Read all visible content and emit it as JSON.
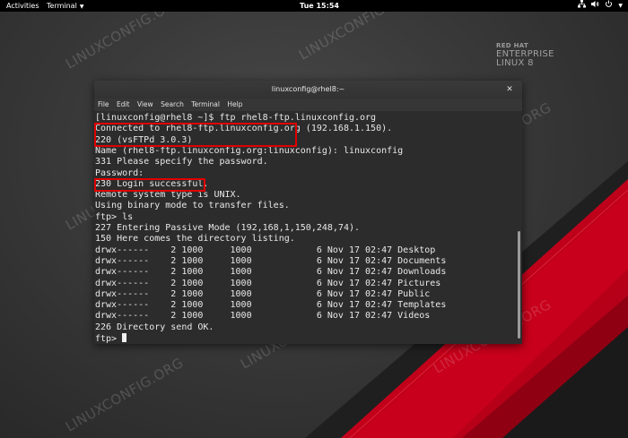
{
  "topbar": {
    "activities": "Activities",
    "app_menu": "Terminal",
    "clock": "Tue 15:54",
    "tray_icons": [
      "network-icon",
      "volume-icon",
      "power-icon",
      "chevron-down-icon"
    ]
  },
  "desktop": {
    "watermark_text": "LINUXCONFIG.ORG",
    "logo": {
      "line1": "RED HAT",
      "line2": "ENTERPRISE",
      "line3": "LINUX 8"
    },
    "colors": {
      "accent_red": "#d3001c",
      "background": "#333333"
    }
  },
  "window": {
    "title": "linuxconfig@rhel8:~",
    "menu": [
      "File",
      "Edit",
      "View",
      "Search",
      "Terminal",
      "Help"
    ],
    "lines": [
      "[linuxconfig@rhel8 ~]$ ftp rhel8-ftp.linuxconfig.org",
      "Connected to rhel8-ftp.linuxconfig.org (192.168.1.150).",
      "220 (vsFTPd 3.0.3)",
      "Name (rhel8-ftp.linuxconfig.org:linuxconfig): linuxconfig",
      "331 Please specify the password.",
      "Password:",
      "230 Login successful.",
      "Remote system type is UNIX.",
      "Using binary mode to transfer files.",
      "ftp> ls",
      "227 Entering Passive Mode (192,168,1,150,248,74).",
      "150 Here comes the directory listing.",
      "drwx------    2 1000     1000            6 Nov 17 02:47 Desktop",
      "drwx------    2 1000     1000            6 Nov 17 02:47 Documents",
      "drwx------    2 1000     1000            6 Nov 17 02:47 Downloads",
      "drwx------    2 1000     1000            6 Nov 17 02:47 Pictures",
      "drwx------    2 1000     1000            6 Nov 17 02:47 Public",
      "drwx------    2 1000     1000            6 Nov 17 02:47 Templates",
      "drwx------    2 1000     1000            6 Nov 17 02:47 Videos",
      "226 Directory send OK.",
      "ftp> "
    ]
  }
}
